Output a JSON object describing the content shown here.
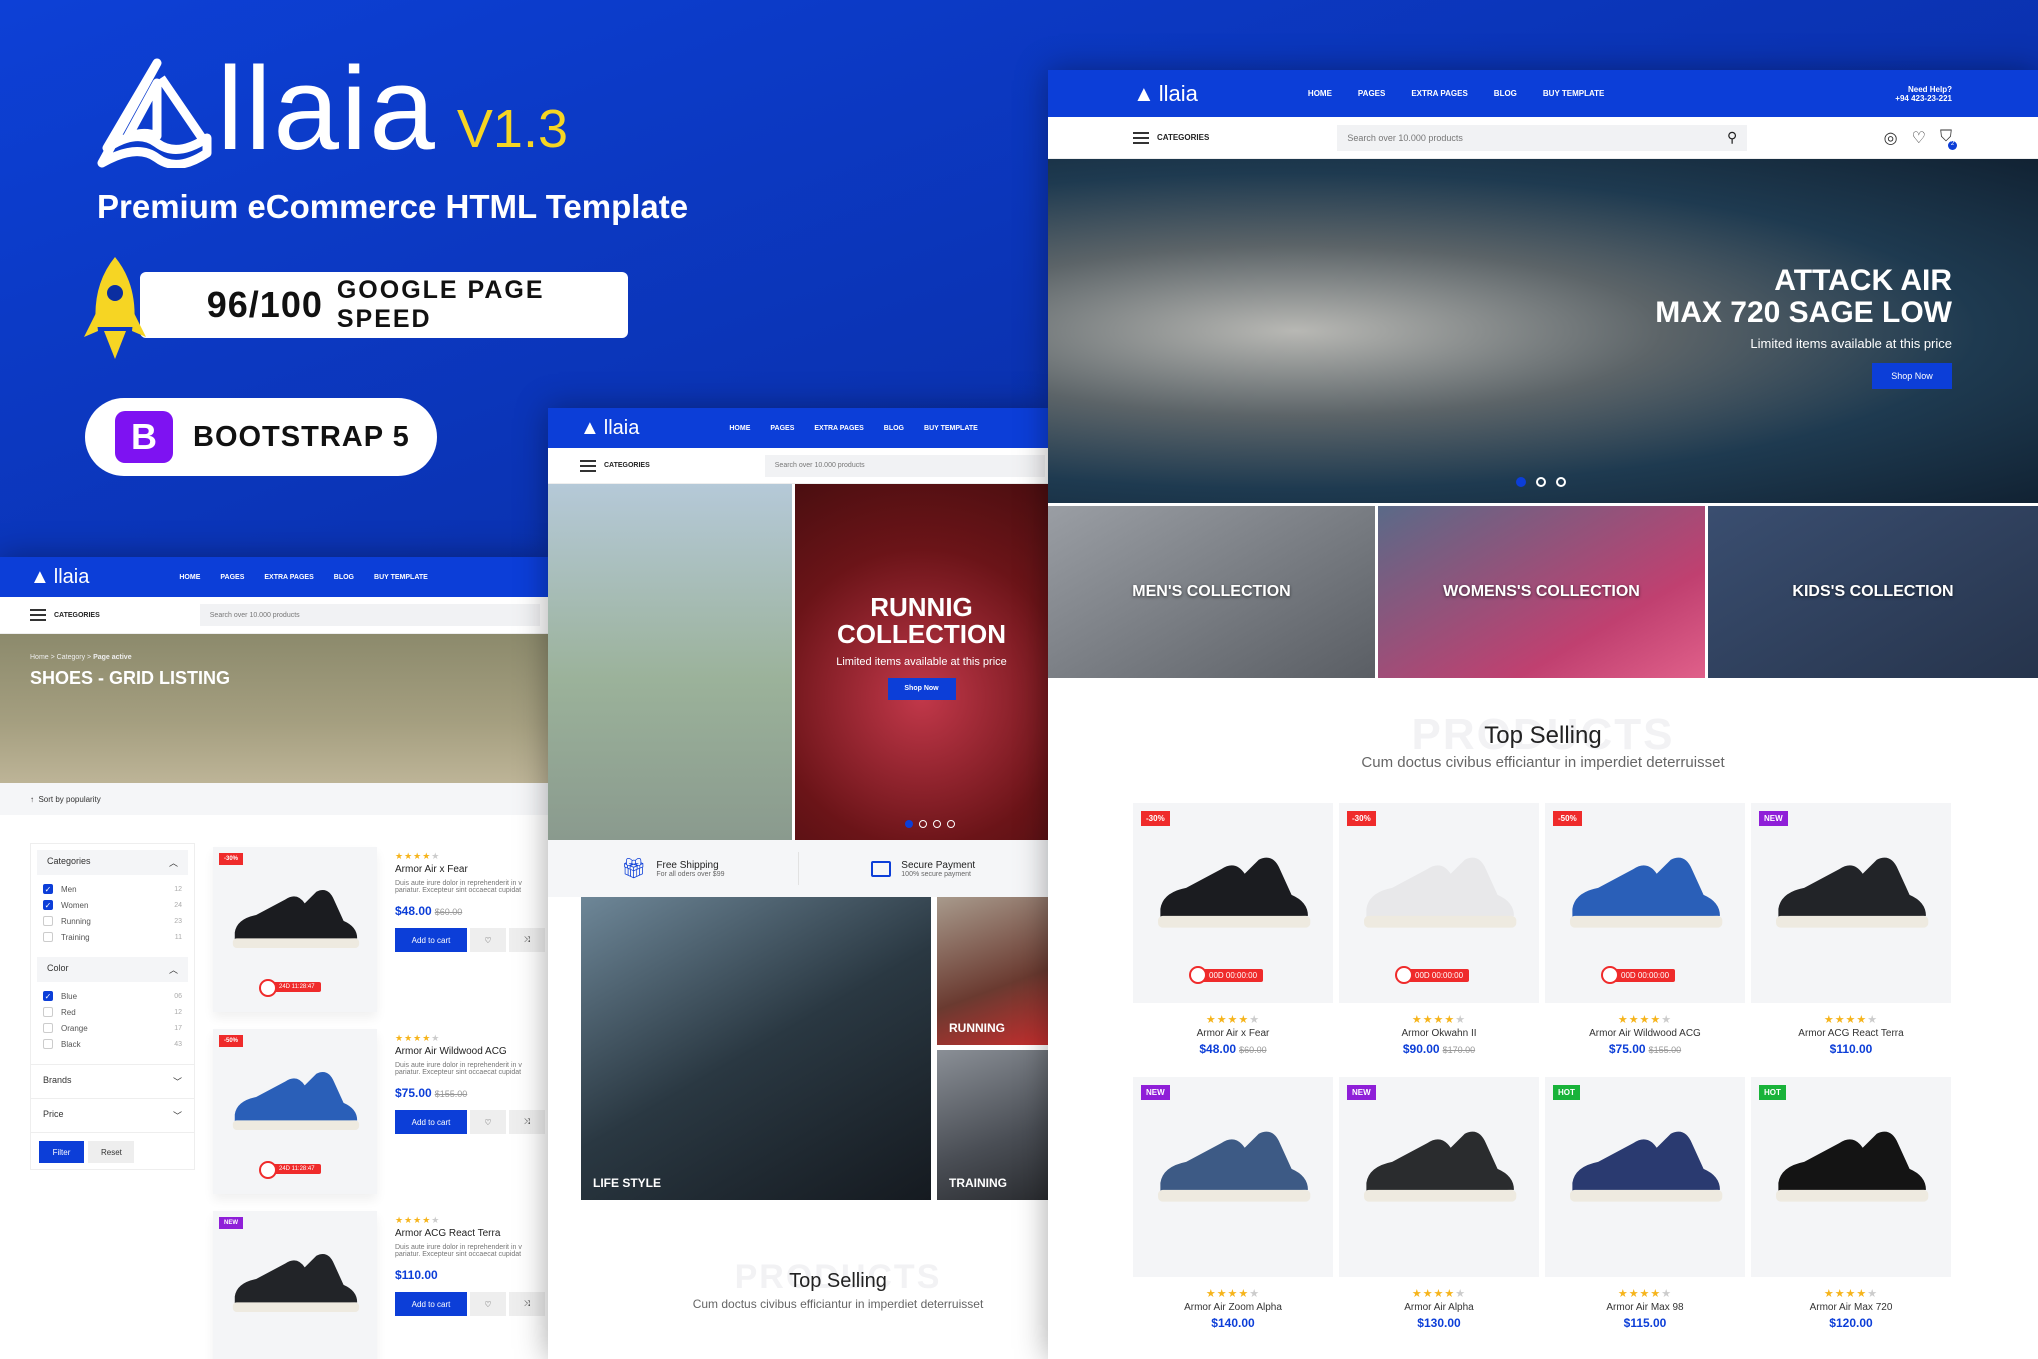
{
  "promo": {
    "logo_text": "llaia",
    "version": "V1.3",
    "subtitle": "Premium eCommerce HTML Template",
    "speed_score": "96/100",
    "speed_label": "GOOGLE PAGE SPEED",
    "bootstrap_letter": "B",
    "bootstrap_label": "BOOTSTRAP 5",
    "colors": {
      "brand": "#0c3ed8",
      "accent": "#f6d523",
      "bootstrap": "#7e12f2"
    }
  },
  "header": {
    "logo": "llaia",
    "nav": [
      "HOME",
      "PAGES",
      "EXTRA PAGES",
      "BLOG",
      "BUY TEMPLATE"
    ],
    "help_title": "Need Help?",
    "help_phone": "+94 423-23-221",
    "categories": "CATEGORIES",
    "search_placeholder": "Search over 10.000 products",
    "cart_count": "2"
  },
  "right": {
    "hero_title_1": "ATTACK AIR",
    "hero_title_2": "MAX 720 SAGE LOW",
    "hero_sub": "Limited items available at this price",
    "hero_button": "Shop Now",
    "collections": [
      "MEN'S COLLECTION",
      "WOMENS'S COLLECTION",
      "KIDS'S COLLECTION"
    ],
    "section_bg": "PRODUCTS",
    "section_title": "Top Selling",
    "section_sub": "Cum doctus civibus efficiantur in imperdiet deterruisset",
    "products": [
      {
        "badge": "-30%",
        "badge_type": "red",
        "timer": "00D 00:00:00",
        "rating": 4,
        "name": "Armor Air x Fear",
        "price": "$48.00",
        "old": "$60.00",
        "color": "#1b1c20"
      },
      {
        "badge": "-30%",
        "badge_type": "red",
        "timer": "00D 00:00:00",
        "rating": 4,
        "name": "Armor Okwahn II",
        "price": "$90.00",
        "old": "$170.00",
        "color": "#e8e8ea"
      },
      {
        "badge": "-50%",
        "badge_type": "red",
        "timer": "00D 00:00:00",
        "rating": 4,
        "name": "Armor Air Wildwood ACG",
        "price": "$75.00",
        "old": "$155.00",
        "color": "#2a5fb8"
      },
      {
        "badge": "NEW",
        "badge_type": "new",
        "timer": "",
        "rating": 4,
        "name": "Armor ACG React Terra",
        "price": "$110.00",
        "old": "",
        "color": "#222428"
      },
      {
        "badge": "NEW",
        "badge_type": "new",
        "timer": "",
        "rating": 4,
        "name": "Armor Air Zoom Alpha",
        "price": "$140.00",
        "old": "",
        "color": "#3d5a85"
      },
      {
        "badge": "NEW",
        "badge_type": "new",
        "timer": "",
        "rating": 4,
        "name": "Armor Air Alpha",
        "price": "$130.00",
        "old": "",
        "color": "#2a2c2e"
      },
      {
        "badge": "HOT",
        "badge_type": "hot",
        "timer": "",
        "rating": 4,
        "name": "Armor Air Max 98",
        "price": "$115.00",
        "old": "",
        "color": "#2a3a70"
      },
      {
        "badge": "HOT",
        "badge_type": "hot",
        "timer": "",
        "rating": 4,
        "name": "Armor Air Max 720",
        "price": "$120.00",
        "old": "",
        "color": "#141414"
      }
    ]
  },
  "middle": {
    "hero_title_1": "RUNNIG",
    "hero_title_2": "COLLECTION",
    "hero_sub": "Limited items available at this price",
    "hero_button": "Shop Now",
    "features": [
      {
        "title": "Free Shipping",
        "sub": "For all oders over $99",
        "icon": "gift-icon"
      },
      {
        "title": "Secure Payment",
        "sub": "100% secure payment",
        "icon": "wallet-icon"
      }
    ],
    "tiles": [
      "LIFE STYLE",
      "RUNNING",
      "TRAINING"
    ],
    "section_bg": "PRODUCTS",
    "section_title": "Top Selling",
    "section_sub": "Cum doctus civibus efficiantur in imperdiet deterruisset"
  },
  "left": {
    "breadcrumb": [
      "Home",
      "Category",
      "Page active"
    ],
    "title": "SHOES - GRID LISTING",
    "sort": "Sort by popularity",
    "filters": {
      "categories_title": "Categories",
      "categories": [
        {
          "label": "Men",
          "count": "12",
          "checked": true
        },
        {
          "label": "Women",
          "count": "24",
          "checked": true
        },
        {
          "label": "Running",
          "count": "23",
          "checked": false
        },
        {
          "label": "Training",
          "count": "11",
          "checked": false
        }
      ],
      "color_title": "Color",
      "colors": [
        {
          "label": "Blue",
          "count": "06",
          "checked": true
        },
        {
          "label": "Red",
          "count": "12",
          "checked": false
        },
        {
          "label": "Orange",
          "count": "17",
          "checked": false
        },
        {
          "label": "Black",
          "count": "43",
          "checked": false
        }
      ],
      "brands_title": "Brands",
      "price_title": "Price",
      "filter_button": "Filter",
      "reset_button": "Reset"
    },
    "products": [
      {
        "badge": "-30%",
        "badge_type": "red",
        "timer": "24D 11:28:47",
        "rating": 4,
        "name": "Armor Air x Fear",
        "desc_1": "Duis aute irure dolor in reprehenderit in v",
        "desc_2": "pariatur. Excepteur sint occaecat cupidat",
        "price": "$48.00",
        "old": "$60.00",
        "cart": "Add to cart",
        "color": "#1b1c20"
      },
      {
        "badge": "-50%",
        "badge_type": "red",
        "timer": "24D 11:28:47",
        "rating": 4,
        "name": "Armor Air Wildwood ACG",
        "desc_1": "Duis aute irure dolor in reprehenderit in v",
        "desc_2": "pariatur. Excepteur sint occaecat cupidat",
        "price": "$75.00",
        "old": "$155.00",
        "cart": "Add to cart",
        "color": "#2a5fb8"
      },
      {
        "badge": "NEW",
        "badge_type": "new",
        "timer": "",
        "rating": 4,
        "name": "Armor ACG React Terra",
        "desc_1": "Duis aute irure dolor in reprehenderit in v",
        "desc_2": "pariatur. Excepteur sint occaecat cupidat",
        "price": "$110.00",
        "old": "",
        "cart": "Add to cart",
        "color": "#222428"
      }
    ]
  }
}
